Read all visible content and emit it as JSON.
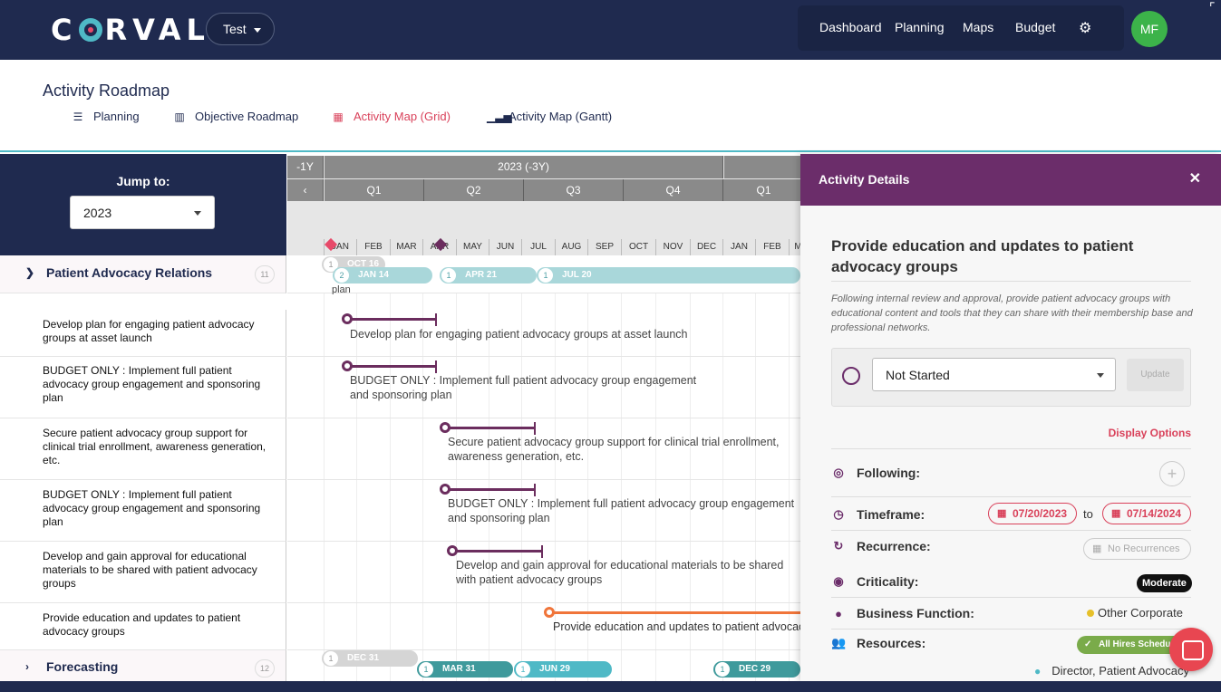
{
  "brand": {
    "logo": "CORVAL",
    "logo_colors": {
      "ring": "#4fb9c6",
      "dot": "#e74a6a"
    }
  },
  "tenant": {
    "label": "Test"
  },
  "nav": {
    "items": [
      "Dashboard",
      "Planning",
      "Maps",
      "Budget"
    ],
    "settings_icon": "gear-icon",
    "avatar": "MF"
  },
  "header": {
    "title": "Activity Roadmap",
    "tabs": [
      {
        "label": "Planning",
        "icon": "list-icon"
      },
      {
        "label": "Objective Roadmap",
        "icon": "map-icon"
      },
      {
        "label": "Activity Map (Grid)",
        "icon": "grid-icon",
        "active": true
      },
      {
        "label": "Activity Map (Gantt)",
        "icon": "gantt-icon"
      }
    ]
  },
  "jump": {
    "label": "Jump to:",
    "value": "2023"
  },
  "timeline": {
    "years": [
      "-1Y",
      "2023 (-3Y)",
      ""
    ],
    "back_icon": "chevron-left-icon",
    "quarters": [
      "Q1",
      "Q2",
      "Q3",
      "Q4",
      "Q1"
    ],
    "months": [
      "JAN",
      "FEB",
      "MAR",
      "APR",
      "MAY",
      "JUN",
      "JUL",
      "AUG",
      "SEP",
      "OCT",
      "NOV",
      "DEC",
      "JAN",
      "FEB",
      "M"
    ]
  },
  "groups": [
    {
      "name": "Patient Advocacy Relations",
      "count": "11",
      "expanded": true,
      "milestones": [
        {
          "n": "1",
          "label": "OCT 16"
        },
        {
          "n": "2",
          "label": "JAN 14"
        },
        {
          "n": "1",
          "label": "APR 21"
        },
        {
          "n": "1",
          "label": "JUL 20"
        }
      ],
      "partial_text": "plan"
    },
    {
      "name": "Forecasting",
      "count": "12",
      "expanded": false,
      "milestones": [
        {
          "n": "1",
          "label": "DEC 31"
        },
        {
          "n": "1",
          "label": "MAR 31"
        },
        {
          "n": "1",
          "label": "JUN 29"
        },
        {
          "n": "1",
          "label": "DEC 29"
        }
      ]
    }
  ],
  "activities": [
    {
      "label": "Develop plan for engaging patient advocacy groups at asset launch",
      "bar_text": "Develop plan for engaging patient advocacy groups at asset launch"
    },
    {
      "label": "BUDGET ONLY : Implement full patient advocacy group engagement and sponsoring plan",
      "bar_text": "BUDGET ONLY : Implement full patient advocacy group engagement and sponsoring plan"
    },
    {
      "label": "Secure patient advocacy group support for clinical trial enrollment, awareness generation, etc.",
      "bar_text": "Secure patient advocacy group support for clinical trial enrollment, awareness generation, etc."
    },
    {
      "label": "BUDGET ONLY : Implement full patient advocacy group engagement and sponsoring plan",
      "bar_text": "BUDGET ONLY : Implement full patient advocacy group engagement and sponsoring plan"
    },
    {
      "label": "Develop and gain approval for educational materials to be shared with patient advocacy groups",
      "bar_text": "Develop and gain approval for educational materials to be shared with patient advocacy groups"
    },
    {
      "label": "Provide education and updates to patient advocacy groups",
      "bar_text": "Provide education and updates to patient advocacy groups"
    }
  ],
  "details": {
    "header": "Activity Details",
    "title": "Provide education and updates to patient advocacy groups",
    "description": "Following internal review and approval, provide patient advocacy groups with educational content and tools that they can share with their membership base and professional networks.",
    "status": "Not Started",
    "update_label": "Update",
    "display_options": "Display Options",
    "following_label": "Following:",
    "timeframe_label": "Timeframe:",
    "start_date": "07/20/2023",
    "to_label": "to",
    "end_date": "07/14/2024",
    "recurrence_label": "Recurrence:",
    "recurrence_value": "No Recurrences",
    "criticality_label": "Criticality:",
    "criticality_value": "Moderate",
    "business_function_label": "Business Function:",
    "business_function_value": "Other Corporate",
    "resources_label": "Resources:",
    "resources_badge": "All Hires Schedu",
    "resource_person": "Director, Patient Advocacy"
  },
  "colors": {
    "navy": "#1f2a4f",
    "plum": "#6b2d6a",
    "accent": "#d9415a",
    "teal": "#4fb9c6",
    "orange": "#f0753a"
  }
}
